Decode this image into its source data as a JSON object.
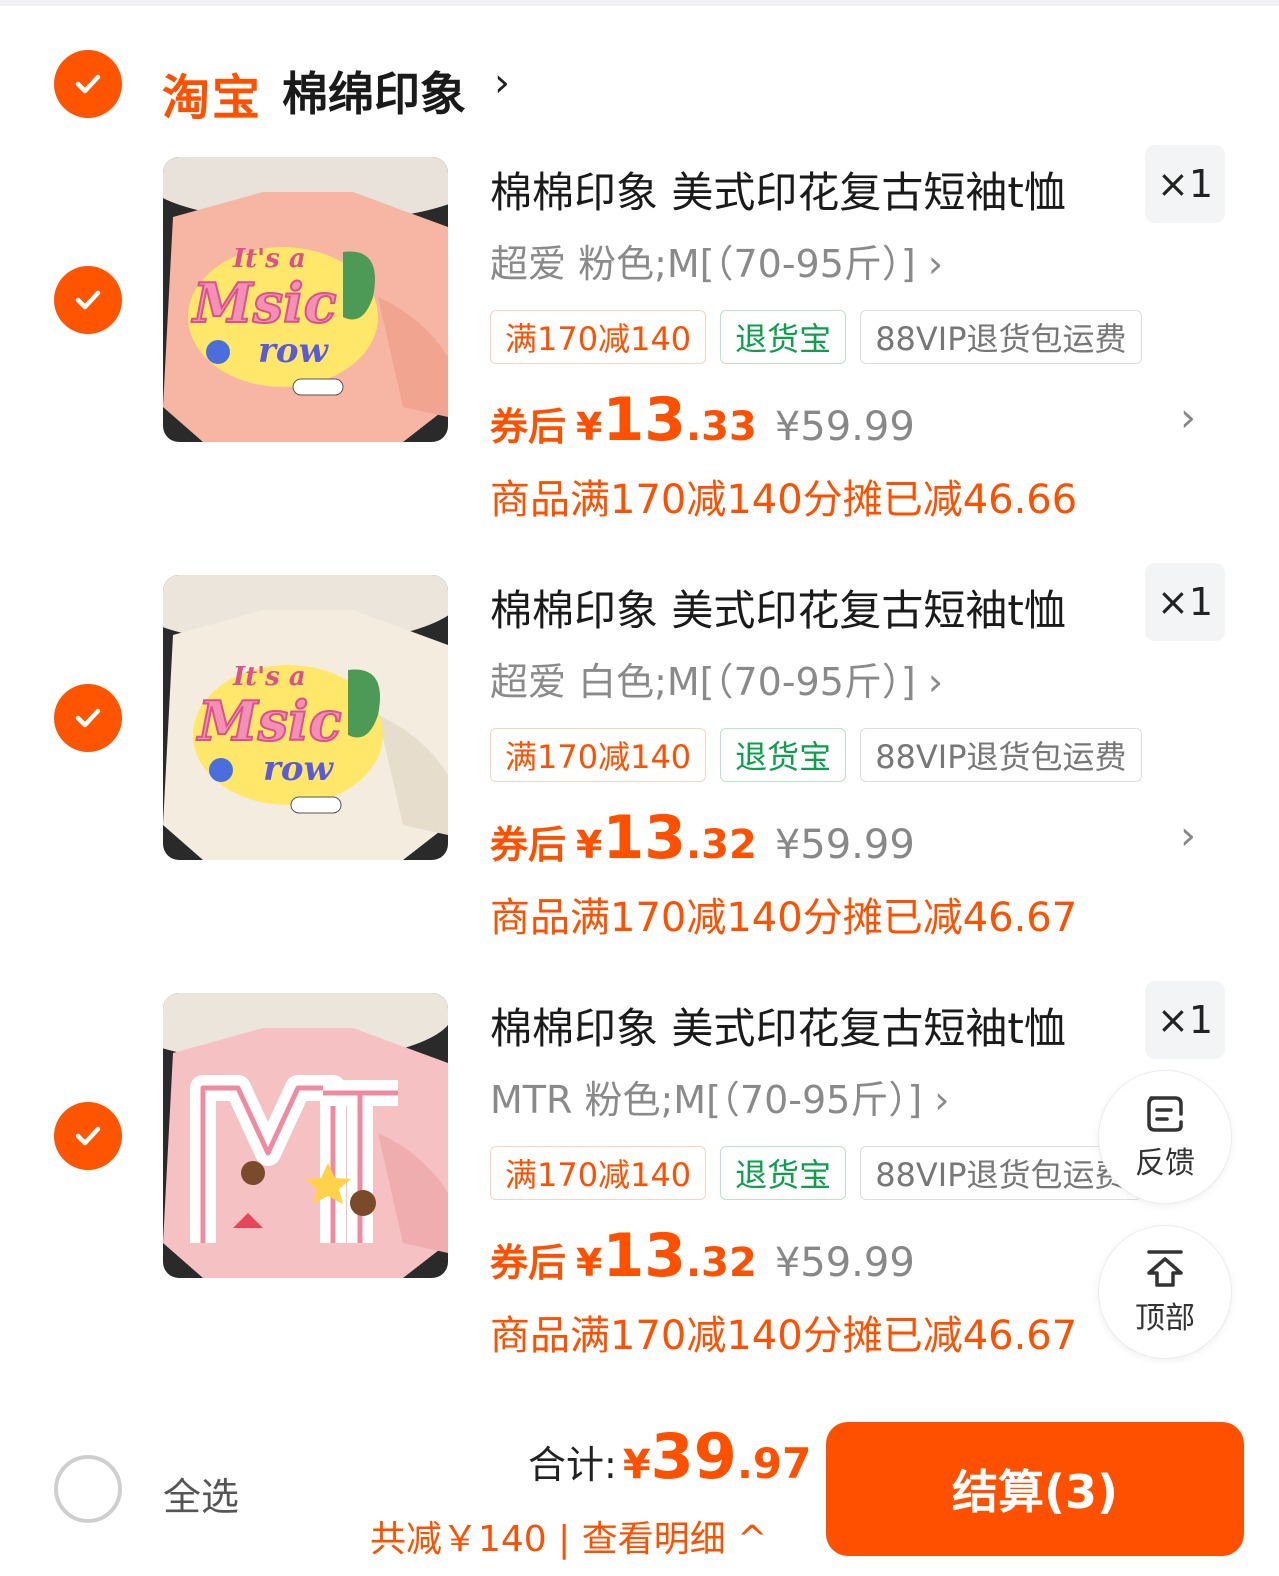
{
  "shop": {
    "platform": "淘宝",
    "name": "棉绵印象",
    "chevron": "›"
  },
  "items": [
    {
      "title": "棉棉印象 美式印花复古短袖t恤",
      "qty": "×1",
      "sku": "超爱 粉色;M[（70-95斤）] ›",
      "tags": [
        "满170减140",
        "退货宝",
        "88VIP退货包运费"
      ],
      "price_label": "券后",
      "price_yen": "¥",
      "price_int": "13",
      "price_dec": ".33",
      "original_price": "¥59.99",
      "discount": "商品满170减140分摊已减46.66",
      "shirt_color": "#f7b6a3"
    },
    {
      "title": "棉棉印象 美式印花复古短袖t恤",
      "qty": "×1",
      "sku": "超爱 白色;M[（70-95斤）] ›",
      "tags": [
        "满170减140",
        "退货宝",
        "88VIP退货包运费"
      ],
      "price_label": "券后",
      "price_yen": "¥",
      "price_int": "13",
      "price_dec": ".32",
      "original_price": "¥59.99",
      "discount": "商品满170减140分摊已减46.67",
      "shirt_color": "#f3ecdf"
    },
    {
      "title": "棉棉印象 美式印花复古短袖t恤",
      "qty": "×1",
      "sku": "MTR 粉色;M[（70-95斤）] ›",
      "tags": [
        "满170减140",
        "退货宝",
        "88VIP退货包运费"
      ],
      "price_label": "券后",
      "price_yen": "¥",
      "price_int": "13",
      "price_dec": ".32",
      "original_price": "¥59.99",
      "discount": "商品满170减140分摊已减46.67",
      "shirt_color": "#f6c1c2"
    }
  ],
  "float_buttons": {
    "feedback": "反馈",
    "top": "顶部"
  },
  "bottom": {
    "select_all": "全选",
    "total_label": "合计:",
    "total_yen": "¥",
    "total_int": "39",
    "total_dec": ".97",
    "saved": "共减￥140 | 查看明细 ^",
    "checkout": "结算(3)"
  },
  "colors": {
    "accent": "#ff5000",
    "check": "#ff5500",
    "green_tag": "#0e9f4c"
  }
}
